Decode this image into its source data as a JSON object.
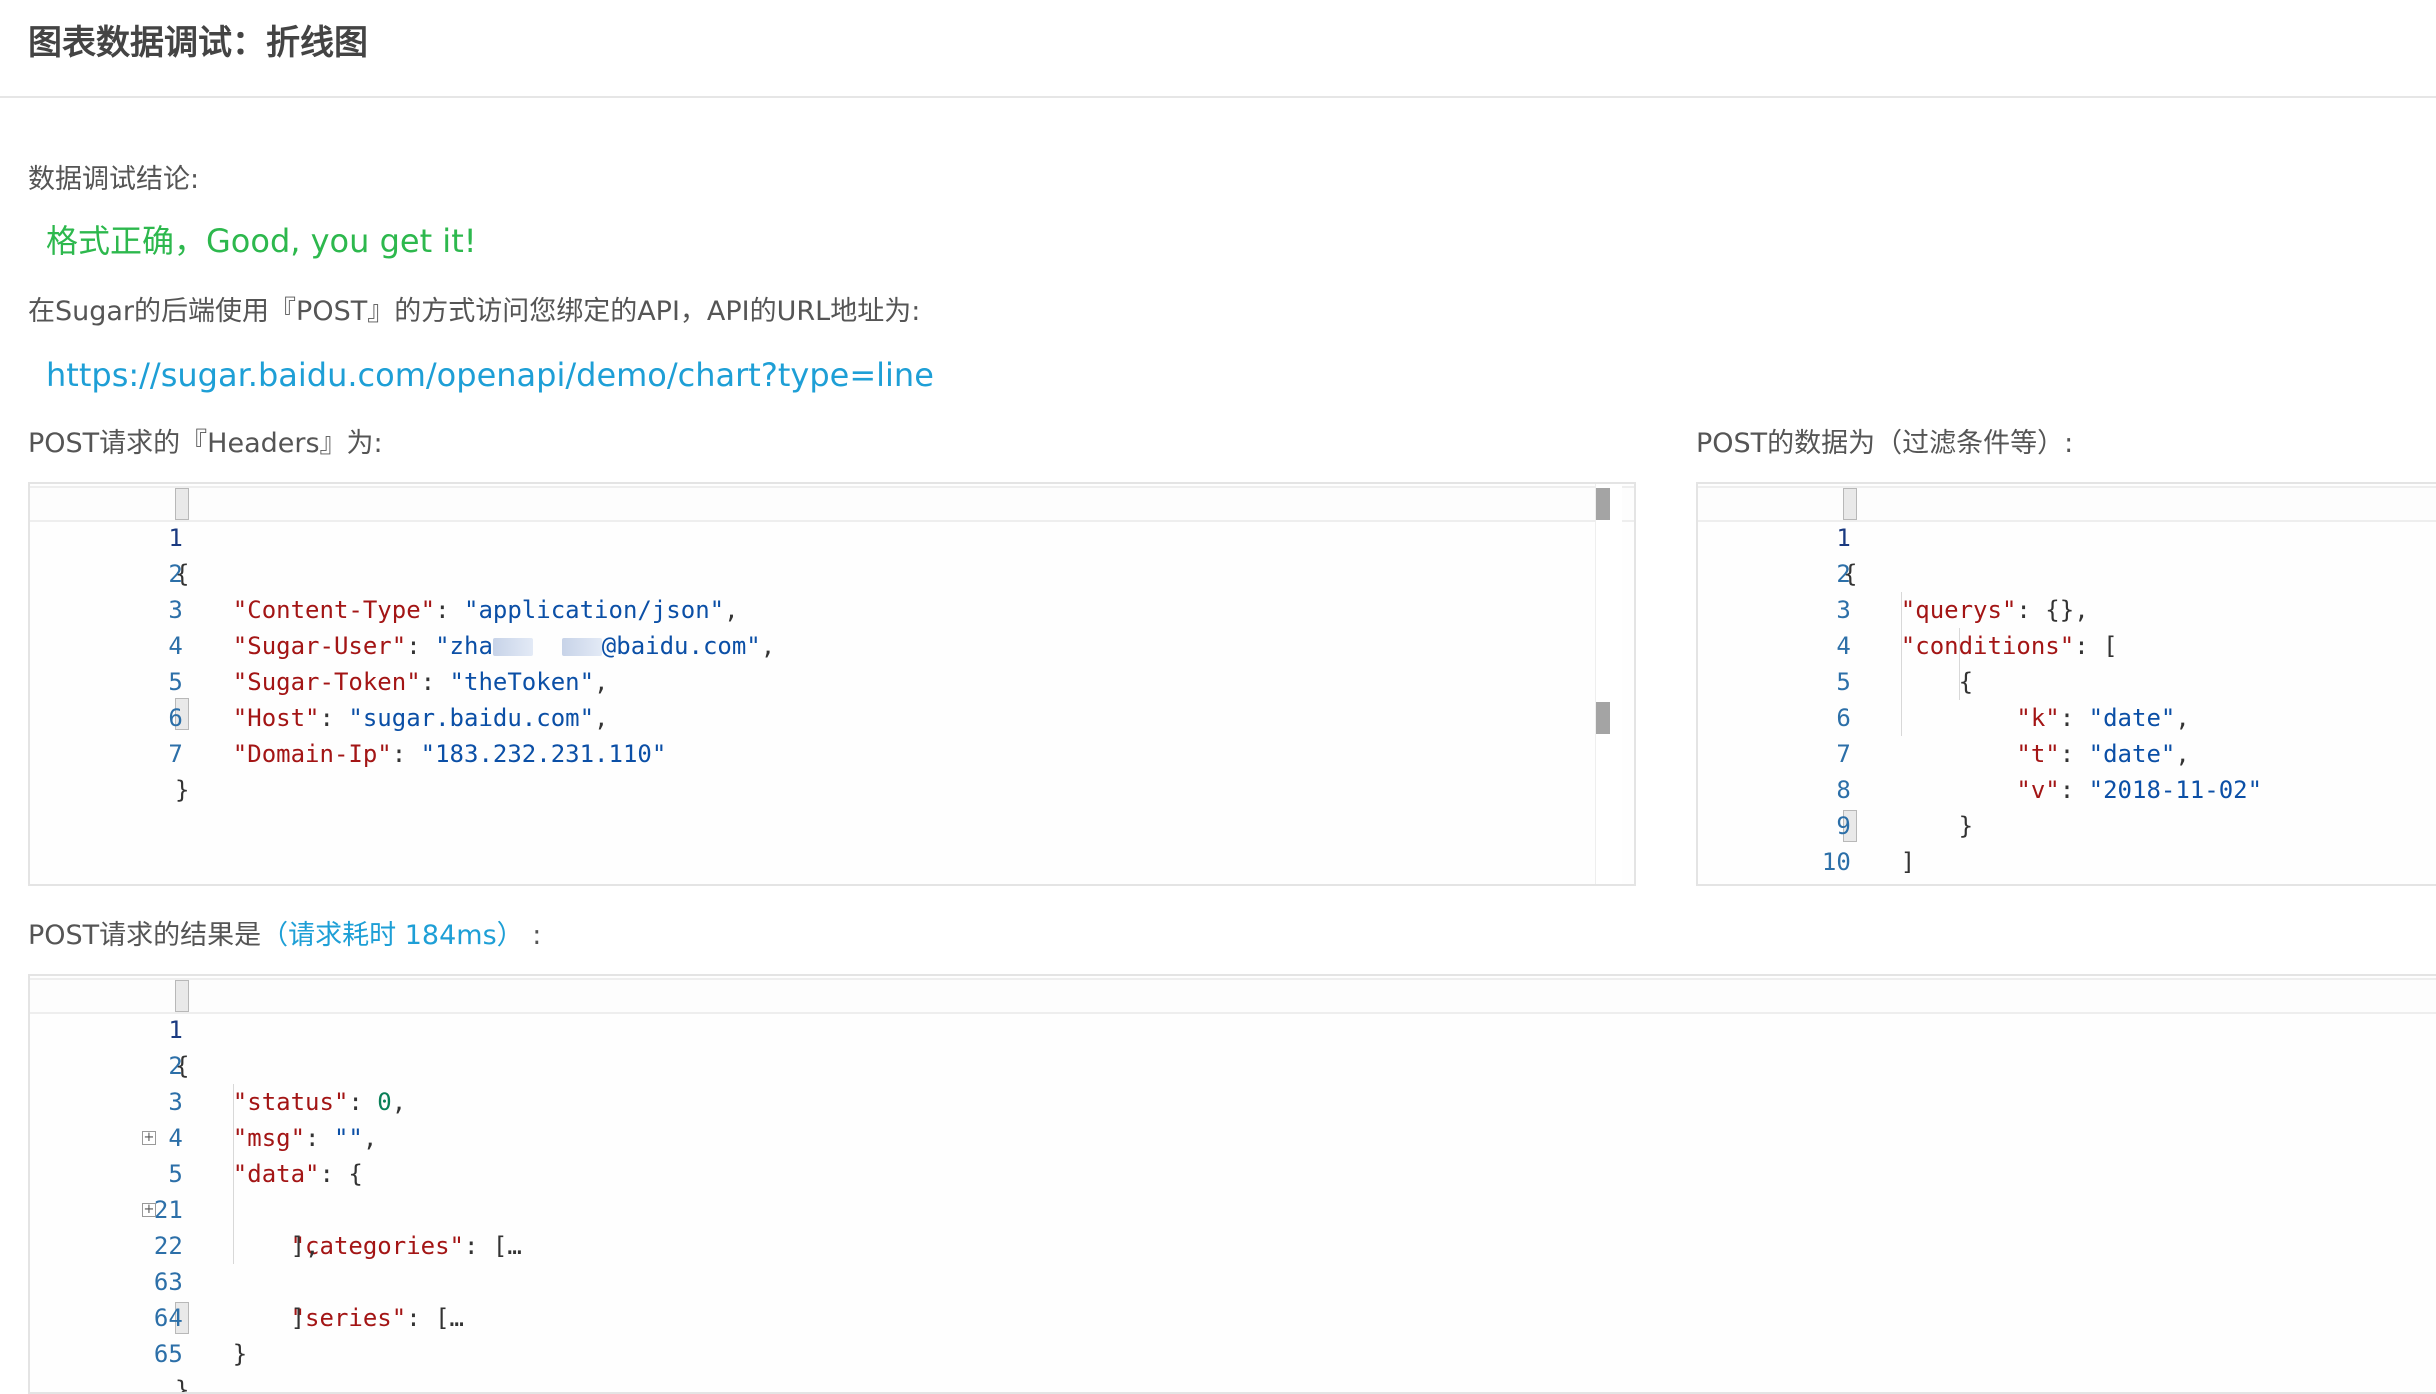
{
  "page": {
    "title": "图表数据调试：折线图"
  },
  "conclusion": {
    "label": "数据调试结论:",
    "result": "格式正确，Good, you get it!"
  },
  "api": {
    "description": "在Sugar的后端使用『POST』的方式访问您绑定的API，API的URL地址为:",
    "url": "https://sugar.baidu.com/openapi/demo/chart?type=line"
  },
  "headers_panel": {
    "label": "POST请求的『Headers』为:",
    "line_numbers": [
      "1",
      "2",
      "3",
      "4",
      "5",
      "6",
      "7"
    ],
    "code": {
      "open": "{",
      "close": "}",
      "rows": [
        {
          "key": "\"Content-Type\"",
          "value": "\"application/json\""
        },
        {
          "key": "\"Sugar-User\"",
          "value_start": "\"zha",
          "value_end": "@baidu.com\""
        },
        {
          "key": "\"Sugar-Token\"",
          "value": "\"theToken\""
        },
        {
          "key": "\"Host\"",
          "value": "\"sugar.baidu.com\""
        },
        {
          "key": "\"Domain-Ip\"",
          "value": "\"183.232.231.110\""
        }
      ]
    }
  },
  "post_data_panel": {
    "label": "POST的数据为（过滤条件等）:",
    "line_numbers": [
      "1",
      "2",
      "3",
      "4",
      "5",
      "6",
      "7",
      "8",
      "9",
      "10"
    ],
    "code": {
      "open": "{",
      "querys_key": "\"querys\"",
      "querys_value": "{}",
      "conditions_key": "\"conditions\"",
      "conditions_open": "[",
      "item_open": "{",
      "k_key": "\"k\"",
      "k_value": "\"date\"",
      "t_key": "\"t\"",
      "t_value": "\"date\"",
      "v_key": "\"v\"",
      "v_value": "\"2018-11-02\"",
      "item_close": "}",
      "conditions_close": "]",
      "close": "}"
    }
  },
  "result_panel": {
    "label": "POST请求的结果是",
    "timing": "（请求耗时 184ms）",
    "colon": ":",
    "line_numbers": [
      "1",
      "2",
      "3",
      "4",
      "5",
      "21",
      "22",
      "63",
      "64",
      "65"
    ],
    "fold_icon": "+",
    "code": {
      "open": "{",
      "status_key": "\"status\"",
      "status_value": "0",
      "msg_key": "\"msg\"",
      "msg_value": "\"\"",
      "data_key": "\"data\"",
      "data_open": "{",
      "categories_key": "\"categories\"",
      "categories_open": "[…",
      "categories_close": "],",
      "series_key": "\"series\"",
      "series_open": "[…",
      "series_close": "]",
      "data_close": "}",
      "close": "}"
    }
  }
}
